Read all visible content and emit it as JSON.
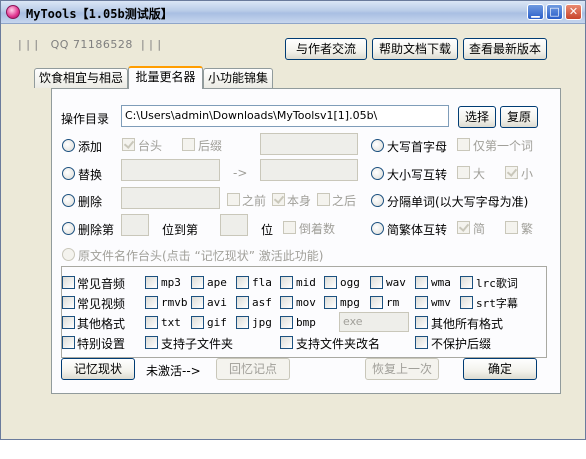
{
  "window": {
    "title": "MyTools【1.05b测试版】",
    "controls": {
      "minimize": "▁",
      "maximize": "□",
      "close": "✕"
    }
  },
  "header": {
    "qq_label": "QQ 71186528",
    "pipes_left": "| | |",
    "pipes_right": "| | |",
    "contact_button": "与作者交流",
    "help_button": "帮助文档下载",
    "latest_button": "查看最新版本"
  },
  "tabs": [
    {
      "label": "饮食相宜与相忌",
      "active": false
    },
    {
      "label": "批量更名器",
      "active": true
    },
    {
      "label": "小功能锦集",
      "active": false
    }
  ],
  "rename": {
    "dir_label": "操作目录",
    "dir_value": "C:\\Users\\admin\\Downloads\\MyToolsv1[1].05b\\",
    "select_button": "选择",
    "restore_button": "复原",
    "add_label": "添加",
    "prefix_label": "台头",
    "suffix_label": "后缀",
    "replace_label": "替换",
    "arrow": "->",
    "delete_label": "删除",
    "before_label": "之前",
    "self_label": "本身",
    "after_label": "之后",
    "delete_nth_label": "删除第",
    "to_nth_label": "位到第",
    "pos_label": "位",
    "reverse_label": "倒着数",
    "capitalize_label": "大写首字母",
    "first_word_label": "仅第一个词",
    "case_swap_label": "大小写互转",
    "upper_label": "大",
    "lower_label": "小",
    "split_words_label": "分隔单词(以大写字母为准)",
    "sim_trad_label": "简繁体互转",
    "simplified_label": "简",
    "traditional_label": "繁",
    "orig_prefix_label": "原文件名作台头(点击 “记忆现状” 激活此功能)"
  },
  "formats": {
    "common_audio": "常见音频",
    "common_video": "常见视频",
    "other_formats": "其他格式",
    "special_settings": "特别设置",
    "audio": [
      "mp3",
      "ape",
      "fla",
      "mid",
      "ogg",
      "wav",
      "wma",
      "lrc歌词"
    ],
    "video": [
      "rmvb",
      "avi",
      "asf",
      "mov",
      "mpg",
      "rm",
      "wmv",
      "srt字幕"
    ],
    "other": [
      "txt",
      "gif",
      "jpg",
      "bmp"
    ],
    "other_input_placeholder": "exe",
    "all_other_formats": "其他所有格式",
    "subfolders": "支持子文件夹",
    "folder_rename": "支持文件夹改名",
    "no_protect_suffix": "不保护后缀"
  },
  "actions": {
    "remember_button": "记忆现状",
    "status_text": "未激活-->",
    "recall_button": "回忆记点",
    "undo_button": "恢复上一次",
    "ok_button": "确定"
  }
}
